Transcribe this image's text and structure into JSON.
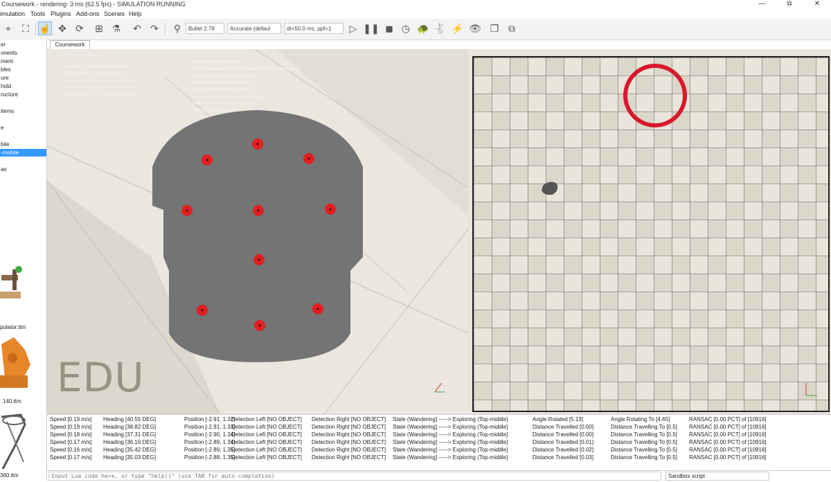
{
  "window": {
    "title": "Coursework - rendering: 3 ms (62.5 fps) - SIMULATION RUNNING",
    "minimize": "—",
    "maximize": "⧉",
    "close": "✕"
  },
  "menu": [
    "imulation",
    "Tools",
    "Plugins",
    "Add-ons",
    "Scenes",
    "Help"
  ],
  "toolbar": {
    "engine": "Bullet 2.78",
    "accuracy": "Accurate (defaul",
    "timestep": "dt=50.0 ms, ppf=1"
  },
  "hierarchy": {
    "items": [
      "er",
      "onents",
      "ment",
      "bles",
      "ure",
      "hold",
      "ructure",
      "",
      "items",
      "",
      "e",
      "",
      "bile",
      "-mobile",
      "",
      "as"
    ],
    "selected_index": 13
  },
  "model_browser": {
    "labels": [
      "pulator.ttm",
      "140.ttm",
      "360.ttm"
    ]
  },
  "scene": {
    "tab_label": "Coursework",
    "camera_label": "...oFittingCamera",
    "watermark": "EDU"
  },
  "status_lines": [
    [
      "Speed [0.19 m/s]",
      "Heading [40.55 DEG]",
      "Position [-2.91, 1.32]",
      "Detection Left [NO OBJECT]",
      "Detection Right [NO OBJECT]",
      "State (Wandering] -----> Exploring (Top-middle]",
      "Angle Rotated [5.13]",
      "Angle Rotating To [4.65]",
      "RANSAC [0.00 PCT] of [10916]",
      ""
    ],
    [
      "Speed [0.19 m/s]",
      "Heading [38.82 DEG]",
      "Position [-2.91, 1.33]",
      "Detection Left [NO OBJECT]",
      "Detection Right [NO OBJECT]",
      "State (Wandering] -----> Exploring (Top-middle]",
      "Distance Travelled [0.00]",
      "Distance Travelling To [0.5]",
      "RANSAC [0.00 PCT] of [10916]",
      ""
    ],
    [
      "Speed [0.18 m/s]",
      "Heading [37.31 DEG]",
      "Position [-2.90, 1.34]",
      "Detection Left [NO OBJECT]",
      "Detection Right [NO OBJECT]",
      "State (Wandering] -----> Exploring (Top-middle]",
      "Distance Travelled [0.00]",
      "Distance Travelling To [0.5]",
      "RANSAC [0.00 PCT] of [10916]",
      ""
    ],
    [
      "Speed [0.17 m/s]",
      "Heading [36.16 DEG]",
      "Position [-2.89, 1.34]",
      "Detection Left [NO OBJECT]",
      "Detection Right [NO OBJECT]",
      "State (Wandering] -----> Exploring (Top-middle]",
      "Distance Travelled [0.01]",
      "Distance Travelling To [0.5]",
      "RANSAC [0.00 PCT] of [10916]",
      ""
    ],
    [
      "Speed [0.16 m/s]",
      "Heading [35.42 DEG]",
      "Position [-2.89, 1.35]",
      "Detection Left [NO OBJECT]",
      "Detection Right [NO OBJECT]",
      "State (Wandering] -----> Exploring (Top-middle]",
      "Distance Travelled [0.02]",
      "Distance Travelling To [0.5]",
      "RANSAC [0.00 PCT] of [10916]",
      ""
    ],
    [
      "Speed [0.17 m/s]",
      "Heading [35.03 DEG]",
      "Position [-2.88, 1.35]",
      "Detection Left [NO OBJECT]",
      "Detection Right [NO OBJECT]",
      "State (Wandering] -----> Exploring (Top-middle]",
      "Distance Travelled [0.03]",
      "Distance Travelling To [0.5]",
      "RANSAC [0.00 PCT] of [10916]",
      ""
    ]
  ],
  "command": {
    "placeholder": "Input Lua code here, or type \"help()\" (use TAB for auto-completion)",
    "script_select": "Sandbox script"
  },
  "colors": {
    "robot_body": "#747474",
    "sensor_dot": "#e02020",
    "target_ring": "#d8182c",
    "grid_line": "#3a3a3a",
    "selection": "#3399ff"
  }
}
